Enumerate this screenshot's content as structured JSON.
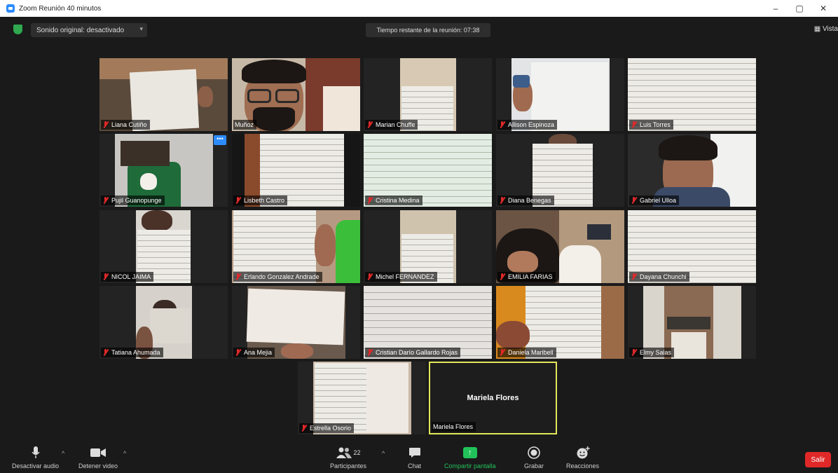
{
  "window": {
    "title": "Zoom Reunión 40 minutos",
    "controls": {
      "minimize": "–",
      "maximize": "▢",
      "close": "✕"
    }
  },
  "topbar": {
    "audio_label": "Sonido original: desactivado",
    "audio_caret": "▾",
    "timer_label": "Tiempo restante de la reunión: 07:38",
    "view_label": "▦ Vista"
  },
  "participants": [
    {
      "name": "Liana Cutiño",
      "muted": true
    },
    {
      "name": "Muñoz",
      "muted": false
    },
    {
      "name": "Marian Chuffe",
      "muted": true
    },
    {
      "name": "Allison Espinoza",
      "muted": true
    },
    {
      "name": "Luis Torres",
      "muted": true
    },
    {
      "name": "Pujil Guanopunge",
      "muted": true
    },
    {
      "name": "Lisbeth Castro",
      "muted": true
    },
    {
      "name": "Cristina Medina",
      "muted": false
    },
    {
      "name": "Diana Benegas",
      "muted": true
    },
    {
      "name": "Gabriel Ulloa",
      "muted": true
    },
    {
      "name": "NICOL JAIMA",
      "muted": true
    },
    {
      "name": "Erlando Gonzalez Andrade",
      "muted": true
    },
    {
      "name": "Michel FERNANDEZ",
      "muted": true
    },
    {
      "name": "EMILIA FARIAS",
      "muted": true
    },
    {
      "name": "Dayana Chunchi",
      "muted": true
    },
    {
      "name": "Tatiana Ahumada",
      "muted": true
    },
    {
      "name": "Ana Mejia",
      "muted": true
    },
    {
      "name": "Cristian Darío Gallardo Rojas",
      "muted": true
    },
    {
      "name": "Daniela Maribell",
      "muted": true
    },
    {
      "name": "Elmy Salas",
      "muted": true
    },
    {
      "name": "Estrella Osorio",
      "muted": true
    },
    {
      "name": "Mariela Flores",
      "muted": false
    }
  ],
  "active_speaker": {
    "display_name": "Mariela Flores"
  },
  "tile_more": "•••",
  "toolbar": {
    "mute_label": "Desactivar audio",
    "video_label": "Detener video",
    "participants_label": "Participantes",
    "participants_count": "22",
    "chat_label": "Chat",
    "share_label": "Compartir pantalla",
    "record_label": "Grabar",
    "reactions_label": "Reacciones",
    "leave_label": "Salir",
    "caret": "^"
  },
  "colors": {
    "accent_blue": "#2d8cff",
    "share_green": "#22c25a",
    "leave_red": "#e02828",
    "active_speaker_border": "#e1e65a"
  }
}
